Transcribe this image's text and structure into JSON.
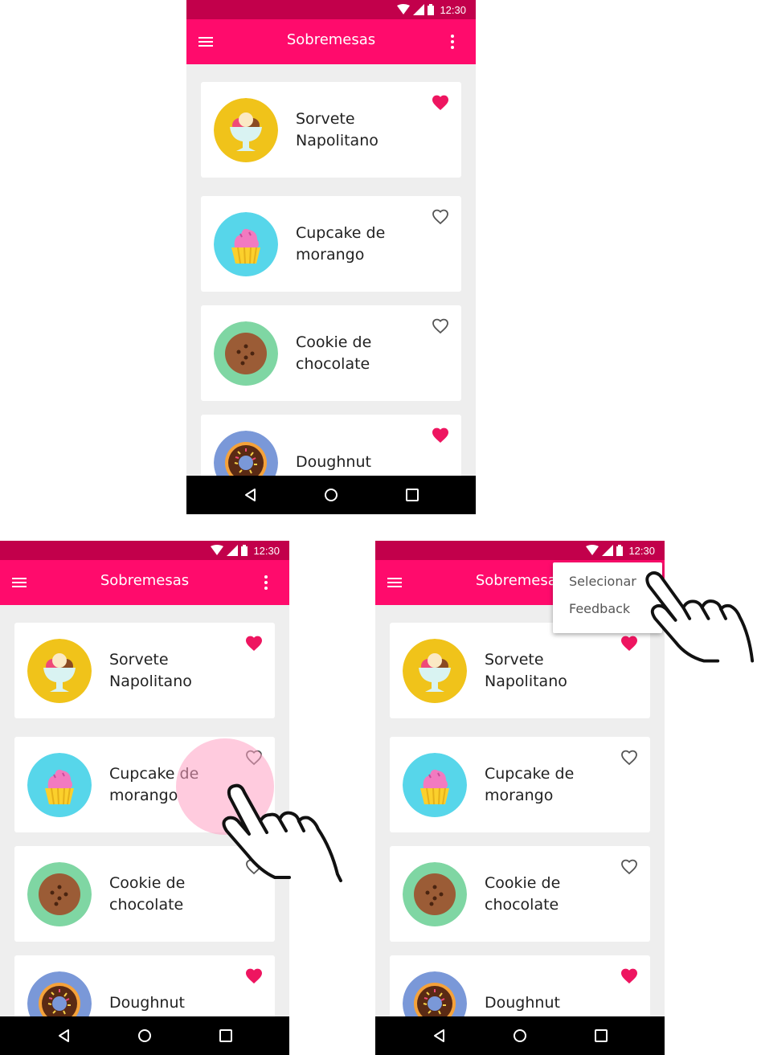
{
  "status_bar": {
    "time": "12:30"
  },
  "app_bar": {
    "title": "Sobremesas"
  },
  "items": [
    {
      "name": "Sorvete Napolitano",
      "icon": "ice-cream-icon",
      "favorite": true
    },
    {
      "name": "Cupcake de morango",
      "icon": "cupcake-icon",
      "favorite": false
    },
    {
      "name": "Cookie de chocolate",
      "icon": "cookie-icon",
      "favorite": false
    },
    {
      "name": "Doughnut",
      "icon": "doughnut-icon",
      "favorite": true
    }
  ],
  "overflow_menu": {
    "items": [
      "Selecionar",
      "Feedback"
    ]
  },
  "colors": {
    "status_bar": "#c2004b",
    "app_bar": "#ff0b6c",
    "favorite": "#ee1560",
    "ice_cream_bg": "#f0c31a",
    "cupcake_bg": "#57d6ea",
    "cookie_bg": "#7fd6a3",
    "doughnut_bg": "#7a98d8"
  }
}
